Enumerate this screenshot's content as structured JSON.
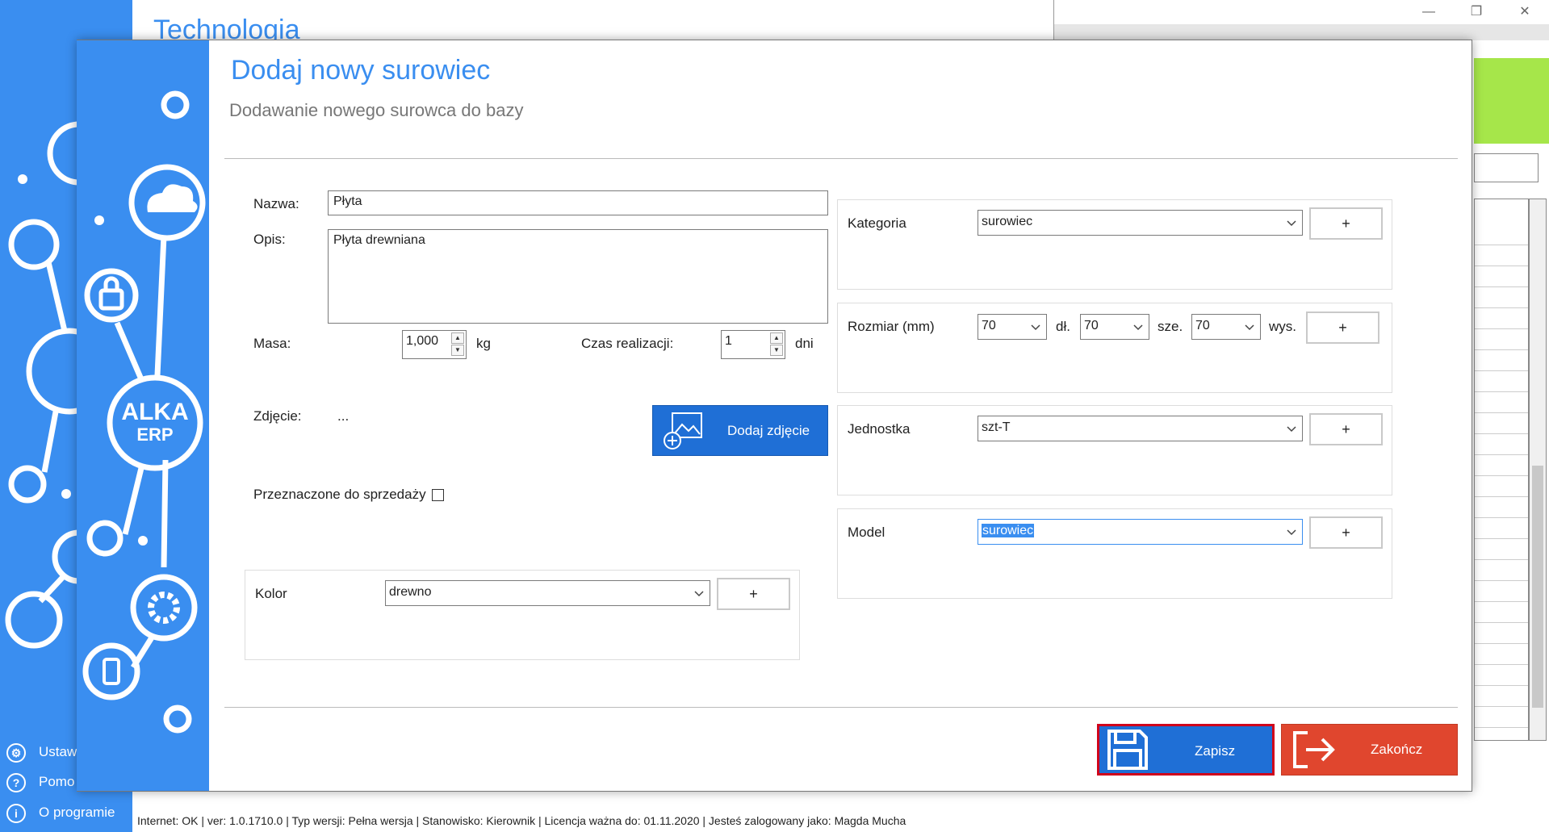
{
  "app": {
    "window_title": "Technologia",
    "minimize_icon": "minimize-icon",
    "restore_icon": "restore-icon",
    "close_icon": "close-icon",
    "bg_menu": [
      {
        "icon": "gear-icon",
        "label": "Ustawi"
      },
      {
        "icon": "help-icon",
        "label": "Pomo"
      },
      {
        "icon": "info-icon",
        "label": "O programie"
      }
    ],
    "accent_color": "#3a8ef0",
    "green_color": "#a6e64a"
  },
  "statusbar": {
    "text": "Internet: OK  |   ver: 1.0.1710.0   |   Typ wersji: Pełna wersja   |   Stanowisko: Kierownik   |   Licencja ważna do: 01.11.2020   |   Jesteś zalogowany jako: Magda Mucha"
  },
  "dialog": {
    "title": "Dodaj nowy surowiec",
    "subtitle": "Dodawanie nowego surowca do bazy",
    "logo_line1": "ALKA",
    "logo_line2": "ERP",
    "form": {
      "name_label": "Nazwa:",
      "name_value": "Płyta",
      "desc_label": "Opis:",
      "desc_value": "Płyta drewniana",
      "mass_label": "Masa:",
      "mass_value": "1,000",
      "mass_unit": "kg",
      "time_label": "Czas realizacji:",
      "time_value": "1",
      "time_unit": "dni",
      "photo_label": "Zdjęcie:",
      "photo_value": "...",
      "photo_button": "Dodaj zdjęcie",
      "for_sale_label": "Przeznaczone do sprzedaży",
      "color_label": "Kolor",
      "color_value": "drewno"
    },
    "right": {
      "category_label": "Kategoria",
      "category_value": "surowiec",
      "size_label": "Rozmiar (mm)",
      "size_length": "70",
      "size_length_unit": "dł.",
      "size_width": "70",
      "size_width_unit": "sze.",
      "size_height": "70",
      "size_height_unit": "wys.",
      "unit_label": "Jednostka",
      "unit_value": "szt-T",
      "model_label": "Model",
      "model_value": "surowiec"
    },
    "plus": "+",
    "save_button": "Zapisz",
    "close_button": "Zakończ",
    "save_color": "#1f6fd6",
    "close_color": "#e0462e"
  }
}
